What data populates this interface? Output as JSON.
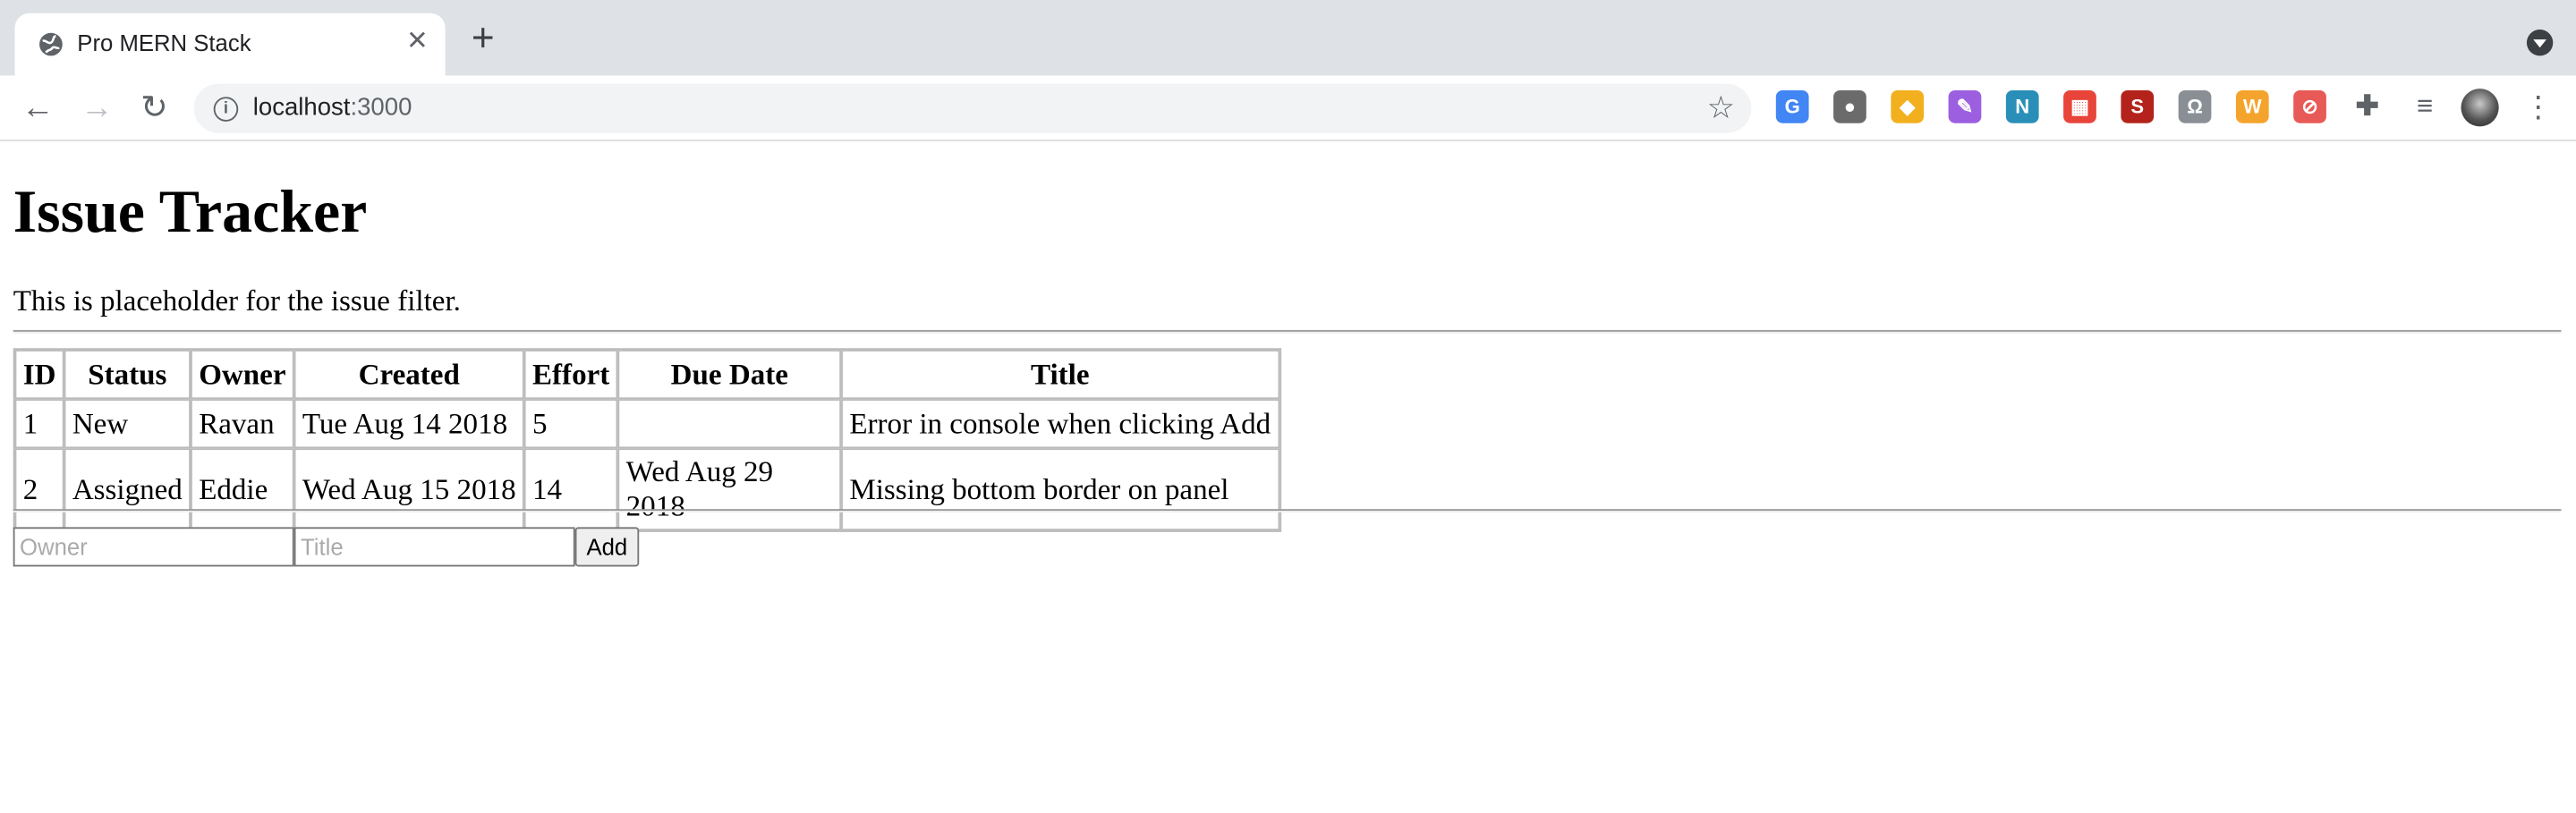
{
  "browser": {
    "tab_title": "Pro MERN Stack",
    "tab_close": "✕",
    "new_tab": "+",
    "url_host": "localhost",
    "url_port": ":3000",
    "info": "i",
    "star": "☆",
    "back": "←",
    "forward": "→",
    "reload": "↻",
    "menu": "⋮",
    "extensions": [
      {
        "name": "google-translate-icon",
        "glyph": "G",
        "color": "#4285f4"
      },
      {
        "name": "tomato-icon",
        "glyph": "●",
        "color": "#6b6b6b"
      },
      {
        "name": "bookmark-shield-icon",
        "glyph": "◆",
        "color": "#f2b01e"
      },
      {
        "name": "quill-icon",
        "glyph": "✎",
        "color": "#9c5fe0"
      },
      {
        "name": "notion-n-icon",
        "glyph": "N",
        "color": "#2a8fb8"
      },
      {
        "name": "calendar-icon",
        "glyph": "▦",
        "color": "#e8443a"
      },
      {
        "name": "s-icon",
        "glyph": "S",
        "color": "#b3231c"
      },
      {
        "name": "loop-icon",
        "glyph": "Ω",
        "color": "#8a8f96"
      },
      {
        "name": "w-icon",
        "glyph": "W",
        "color": "#f4a42c"
      },
      {
        "name": "shield-icon",
        "glyph": "⊘",
        "color": "#e85a57"
      },
      {
        "name": "puzzle-icon",
        "glyph": "✚",
        "color": "#5f6368"
      },
      {
        "name": "reading-list-icon",
        "glyph": "≡",
        "color": "#5f6368"
      }
    ]
  },
  "page": {
    "title": "Issue Tracker",
    "filter_text": "This is placeholder for the issue filter.",
    "table": {
      "headers": [
        "ID",
        "Status",
        "Owner",
        "Created",
        "Effort",
        "Due Date",
        "Title"
      ],
      "rows": [
        [
          "1",
          "New",
          "Ravan",
          "Tue Aug 14 2018",
          "5",
          "",
          "Error in console when clicking Add"
        ],
        [
          "2",
          "Assigned",
          "Eddie",
          "Wed Aug 15 2018",
          "14",
          "Wed Aug 29 2018",
          "Missing bottom border on panel"
        ]
      ]
    },
    "form": {
      "owner_placeholder": "Owner",
      "title_placeholder": "Title",
      "add_label": "Add"
    }
  }
}
